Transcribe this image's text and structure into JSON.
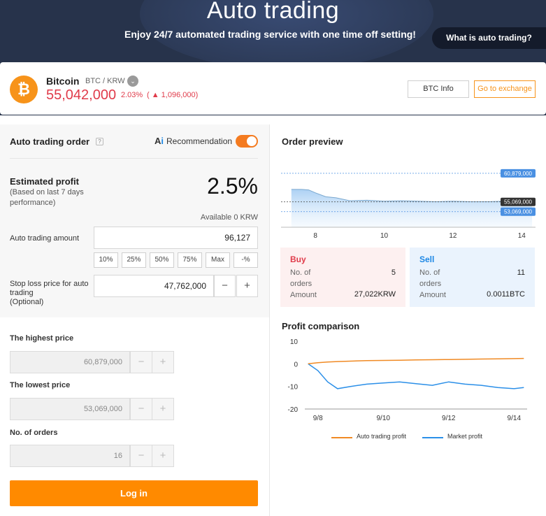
{
  "hero": {
    "title": "Auto trading",
    "subtitle": "Enjoy 24/7 automated trading service with one time off setting!",
    "what_is_button": "What is auto trading?"
  },
  "coin": {
    "logo_symbol": "₿",
    "name": "Bitcoin",
    "pair": "BTC / KRW",
    "caret": "⌄",
    "price": "55,042,000",
    "change_pct": "2.03%",
    "change_abs": "( ▲ 1,096,000)",
    "btc_info_button": "BTC Info",
    "exchange_button": "Go to exchange",
    "accent_color": "#f7931a",
    "up_color": "#e03b4a"
  },
  "order_form": {
    "title": "Auto trading order",
    "help": "?",
    "ai_icon_a": "A",
    "ai_icon_i": "i",
    "recommendation_label": "Recommendation",
    "recommendation_on": true,
    "estimated_profit_label": "Estimated profit",
    "estimated_profit_note": "(Based on last 7 days performance)",
    "estimated_profit_value": "2.5%",
    "available": "Available 0 KRW",
    "amount_label": "Auto trading amount",
    "amount_value": "96,127",
    "pct_buttons": [
      "10%",
      "25%",
      "50%",
      "75%",
      "Max",
      "-%"
    ],
    "stop_loss_label": "Stop loss price for auto trading",
    "stop_loss_optional": "(Optional)",
    "stop_loss_value": "47,762,000",
    "minus": "−",
    "plus": "+",
    "highest_label": "The highest price",
    "highest_value": "60,879,000",
    "lowest_label": "The lowest price",
    "lowest_value": "53,069,000",
    "orders_label": "No. of orders",
    "orders_value": "16",
    "login_button": "Log in",
    "login_color": "#ff8a00"
  },
  "order_preview": {
    "title": "Order preview",
    "x_ticks": [
      "8",
      "10",
      "12",
      "14"
    ],
    "price_tags": [
      "60,879,000",
      "55,069,000",
      "53,069,000"
    ],
    "buy": {
      "title": "Buy",
      "orders_label": "No. of orders",
      "orders": "5",
      "amount_label": "Amount",
      "amount": "27,022KRW"
    },
    "sell": {
      "title": "Sell",
      "orders_label": "No. of orders",
      "orders": "11",
      "amount_label": "Amount",
      "amount": "0.0011BTC"
    }
  },
  "profit_comparison": {
    "title": "Profit comparison",
    "legend_auto": "Auto trading profit",
    "legend_market": "Market profit",
    "auto_color": "#f08a24",
    "market_color": "#2b8fe8"
  },
  "chart_data": [
    {
      "type": "area",
      "x": [
        7.3,
        7.6,
        7.8,
        8.0,
        8.3,
        8.6,
        9.0,
        9.5,
        10.0,
        10.5,
        11.0,
        11.5,
        12.0,
        12.5,
        13.0,
        13.5,
        14.0,
        14.3
      ],
      "values": [
        57.6,
        57.6,
        57.5,
        56.9,
        56.1,
        55.9,
        55.3,
        55.4,
        55.2,
        55.3,
        55.2,
        55.1,
        55.2,
        55.1,
        55.1,
        55.2,
        55.1,
        55.07
      ],
      "xlim": [
        7.0,
        14.4
      ],
      "ylim": [
        49.9,
        62.0
      ],
      "reference_lines": [
        60.879,
        55.069,
        53.069
      ]
    },
    {
      "type": "line",
      "x": [
        7.7,
        8.0,
        8.3,
        8.6,
        9.0,
        9.5,
        10.0,
        10.5,
        11.0,
        11.5,
        12.0,
        12.5,
        13.0,
        13.5,
        14.0,
        14.3
      ],
      "ylim": [
        -20,
        10
      ],
      "xlim": [
        7.6,
        14.4
      ],
      "x_ticks": [
        "9/8",
        "9/10",
        "9/12",
        "9/14"
      ],
      "y_ticks": [
        "10",
        "0",
        "-10",
        "-20"
      ],
      "series": [
        {
          "name": "Auto trading profit",
          "values": [
            0,
            0.5,
            0.8,
            1.0,
            1.2,
            1.4,
            1.5,
            1.6,
            1.7,
            1.8,
            1.9,
            2.0,
            2.1,
            2.2,
            2.3,
            2.4
          ]
        },
        {
          "name": "Market profit",
          "values": [
            0,
            -3,
            -8,
            -11,
            -10,
            -9,
            -8.5,
            -8,
            -8.8,
            -9.5,
            -8,
            -9,
            -9.5,
            -10.5,
            -11,
            -10.5
          ]
        }
      ]
    }
  ]
}
